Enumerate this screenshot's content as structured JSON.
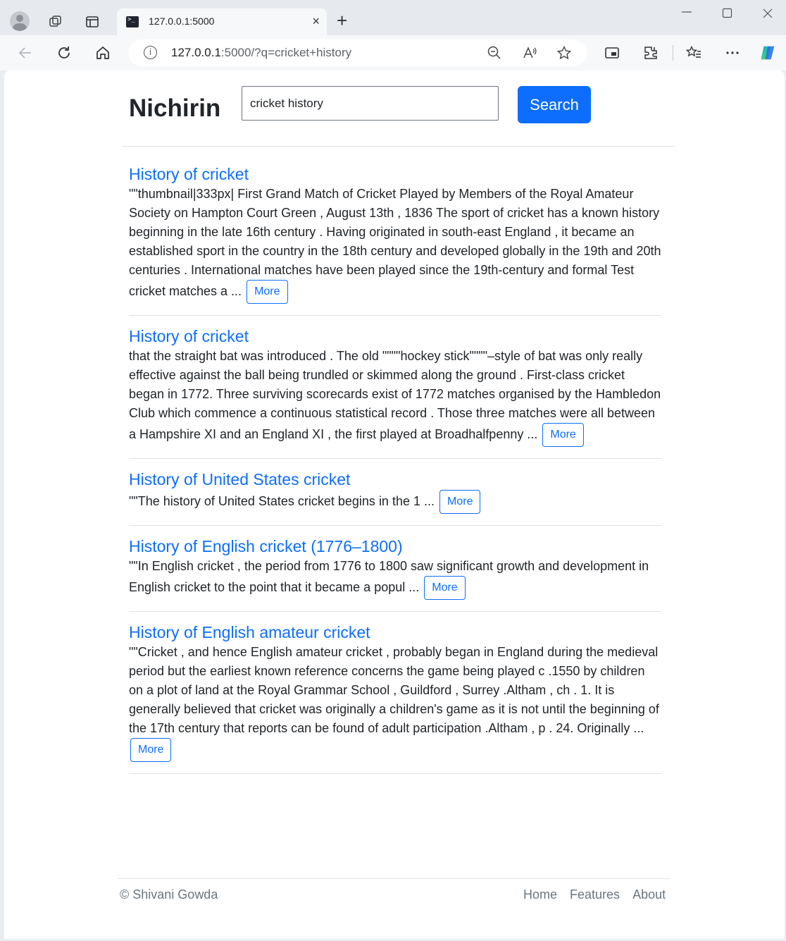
{
  "browser": {
    "tab_title": "127.0.0.1:5000",
    "url_host": "127.0.0.1",
    "url_rest": ":5000/?q=cricket+history",
    "new_tab": "+",
    "tab_close": "×"
  },
  "header": {
    "brand": "Nichirin",
    "search_value": "cricket history",
    "search_button": "Search"
  },
  "results": [
    {
      "title": "History of cricket",
      "snippet": "\"\"thumbnail|333px| First Grand Match of Cricket Played by Members of the Royal Amateur Society on Hampton Court Green , August 13th , 1836 The sport of cricket has a known history beginning in the late 16th century . Having originated in south-east England , it became an established sport in the country in the 18th century and developed globally in the 19th and 20th centuries . International matches have been played since the 19th-century and formal Test cricket matches a ...",
      "more": "More"
    },
    {
      "title": "History of cricket",
      "snippet": "that the straight bat was introduced . The old \"\"\"\"hockey stick\"\"\"\"–style of bat was only really effective against the ball being trundled or skimmed along the ground . First-class cricket began in 1772. Three surviving scorecards exist of 1772 matches organised by the Hambledon Club which commence a continuous statistical record . Those three matches were all between a Hampshire XI and an England XI , the first played at Broadhalfpenny ...",
      "more": "More"
    },
    {
      "title": "History of United States cricket",
      "snippet": "\"\"The history of United States cricket begins in the 1 ...",
      "more": "More"
    },
    {
      "title": "History of English cricket (1776–1800)",
      "snippet": "\"\"In English cricket , the period from 1776 to 1800 saw significant growth and development in English cricket to the point that it became a popul ...",
      "more": "More"
    },
    {
      "title": "History of English amateur cricket",
      "snippet": "\"\"Cricket , and hence English amateur cricket , probably began in England during the medieval period but the earliest known reference concerns the game being played c .1550 by children on a plot of land at the Royal Grammar School , Guildford , Surrey .Altham , ch . 1. It is generally believed that cricket was originally a children's game as it is not until the beginning of the 17th century that reports can be found of adult participation .Altham , p . 24. Originally ...",
      "more": "More"
    }
  ],
  "footer": {
    "copyright": "© Shivani Gowda",
    "links": [
      "Home",
      "Features",
      "About"
    ]
  }
}
